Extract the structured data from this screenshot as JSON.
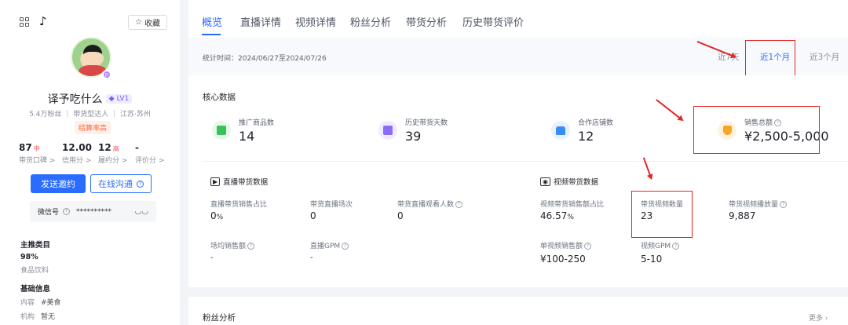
{
  "sidebar": {
    "favorite_label": "收藏",
    "name": "译予吃什么",
    "level": "LV1",
    "meta": "5.4万粉丝 ｜ 带货型达人 ｜ 江苏·苏州",
    "tag": "结算率高",
    "stats": [
      {
        "value": "87",
        "grade": "中",
        "label": "带货口碑 >"
      },
      {
        "value": "12.00",
        "grade": "",
        "label": "信用分 >"
      },
      {
        "value": "12",
        "grade": "高",
        "label": "履约分 >"
      },
      {
        "value": "-",
        "grade": "",
        "label": "评价分 >"
      }
    ],
    "invite_button": "发送邀约",
    "chat_button": "在线沟通",
    "wechat_label": "微信号",
    "wechat_value": "**********",
    "category_title": "主推类目",
    "category_pct": "98%",
    "category_name": "食品饮料",
    "basic_title": "基础信息",
    "content_label": "内容",
    "content_value": "#美食",
    "org_label": "机构",
    "org_value": "暂无"
  },
  "tabs": [
    "概览",
    "直播详情",
    "视频详情",
    "粉丝分析",
    "带货分析",
    "历史带货评价"
  ],
  "range": {
    "date_text": "统计时间：2024/06/27至2024/07/26",
    "options": [
      "近7天",
      "近1个月",
      "近3个月"
    ]
  },
  "core": {
    "title": "核心数据",
    "kpis": [
      {
        "label": "推广商品数",
        "value": "14"
      },
      {
        "label": "历史带货天数",
        "value": "39"
      },
      {
        "label": "合作店铺数",
        "value": "12"
      },
      {
        "label": "销售总额",
        "value": "¥2,500-5,000"
      }
    ],
    "live": {
      "title": "直播带货数据",
      "metrics": [
        {
          "label": "直播带货销售占比",
          "value": "0",
          "unit": "%"
        },
        {
          "label": "带货直播场次",
          "value": "0",
          "unit": ""
        },
        {
          "label": "带货直播观看人数",
          "value": "0",
          "unit": ""
        },
        {
          "label": "场均销售额",
          "value": "-",
          "unit": ""
        },
        {
          "label": "直播GPM",
          "value": "-",
          "unit": ""
        }
      ]
    },
    "video": {
      "title": "视频带货数据",
      "metrics": [
        {
          "label": "视频带货销售额占比",
          "value": "46.57",
          "unit": "%"
        },
        {
          "label": "带货视频数量",
          "value": "23",
          "unit": ""
        },
        {
          "label": "带货视频播放量",
          "value": "9,887",
          "unit": ""
        },
        {
          "label": "单视频销售额",
          "value": "¥100-250",
          "unit": ""
        },
        {
          "label": "视频GPM",
          "value": "5-10",
          "unit": ""
        }
      ]
    }
  },
  "fans": {
    "title": "粉丝分析",
    "more": "更多"
  },
  "colors": {
    "accent": "#2a6cff",
    "annotation": "#e32626"
  }
}
